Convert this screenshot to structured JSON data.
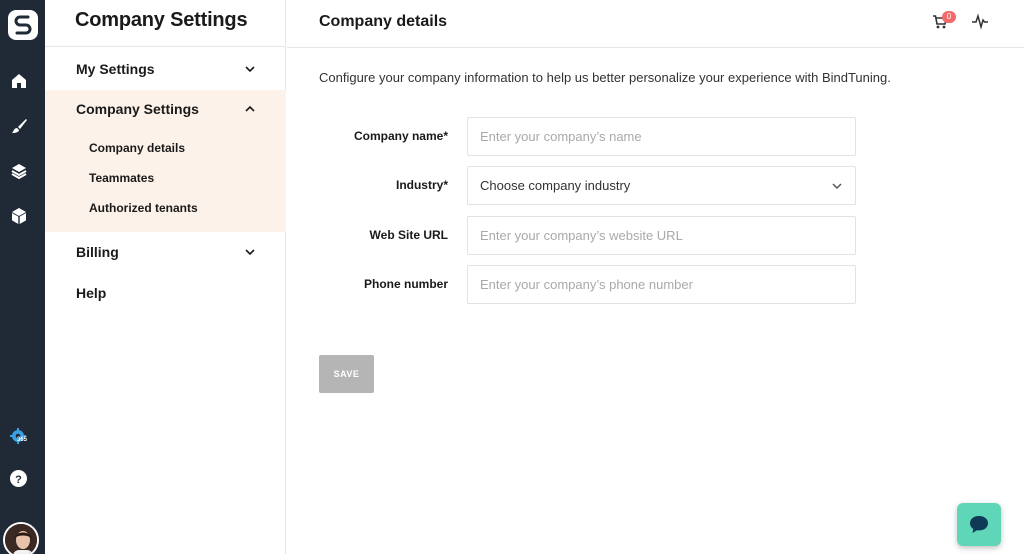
{
  "rail": {
    "logo": "bindtuning-logo",
    "icons": [
      "home-icon",
      "brush-icon",
      "layers-icon",
      "cube-icon",
      "gear-365-icon",
      "help-icon"
    ],
    "gear_badge": "365",
    "help_glyph": "?"
  },
  "sidebar": {
    "title": "Company Settings",
    "items": [
      {
        "label": "My Settings",
        "expanded": false
      },
      {
        "label": "Company Settings",
        "expanded": true,
        "children": [
          "Company details",
          "Teammates",
          "Authorized tenants"
        ]
      },
      {
        "label": "Billing",
        "expanded": false
      },
      {
        "label": "Help"
      }
    ]
  },
  "header": {
    "title": "Company details",
    "cart_count": "0"
  },
  "main": {
    "intro": "Configure your company information to help us better personalize your experience with BindTuning.",
    "fields": [
      {
        "label": "Company name*",
        "placeholder": "Enter your company’s name"
      },
      {
        "label": "Industry*",
        "value": "Choose company industry"
      },
      {
        "label": "Web Site URL",
        "placeholder": "Enter your company’s website URL"
      },
      {
        "label": "Phone number",
        "placeholder": "Enter your company’s phone number"
      }
    ],
    "save_label": "SAVE"
  },
  "colors": {
    "rail_bg": "#1f2a36",
    "active_group_bg": "#fcf2ea",
    "badge": "#f26a6a",
    "chat_button": "#5fd6b8",
    "save_disabled": "#b5b5b5"
  }
}
